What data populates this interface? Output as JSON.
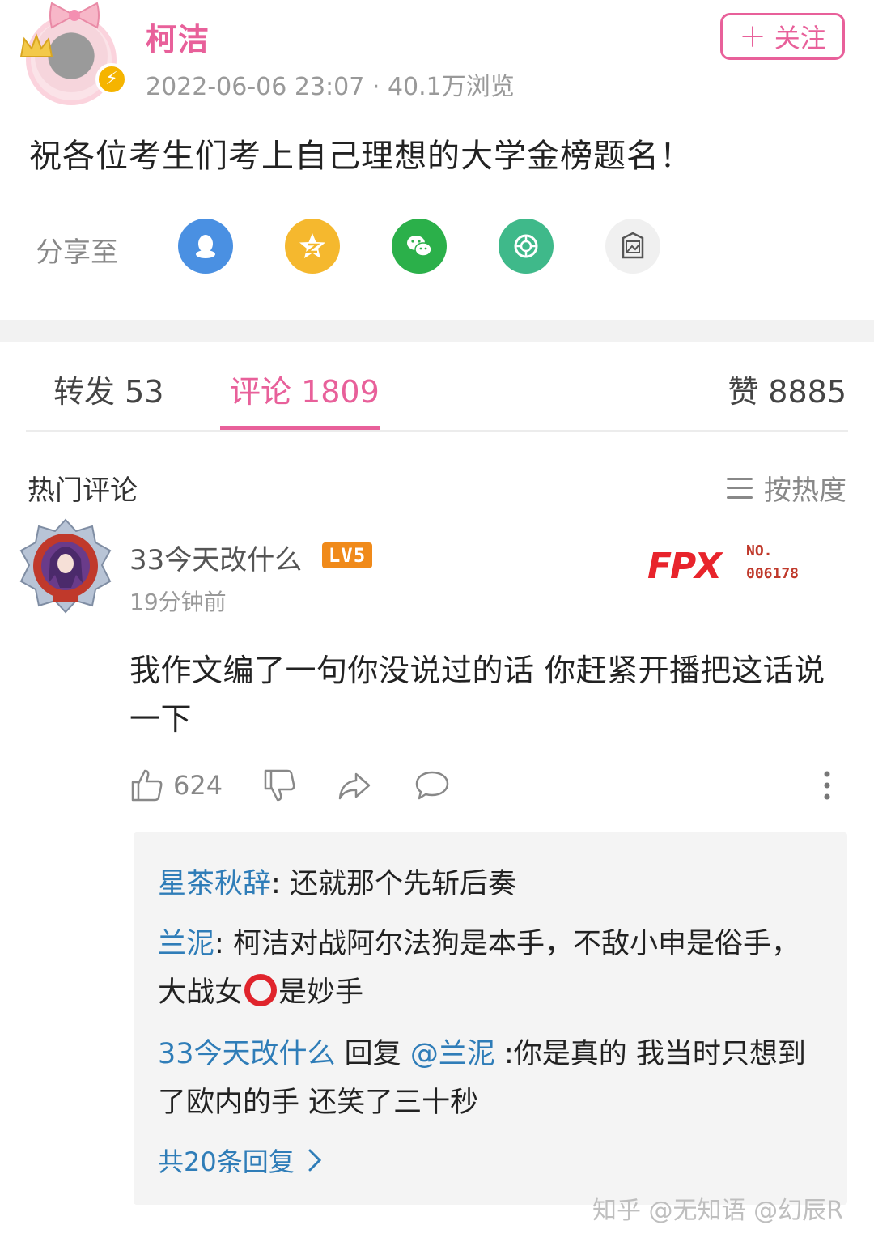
{
  "post": {
    "author": "柯洁",
    "meta": "2022-06-06 23:07 · 40.1万浏览",
    "follow_label": "关注",
    "body": "祝各位考生们考上自己理想的大学金榜题名！"
  },
  "share": {
    "label": "分享至",
    "targets": [
      {
        "icon": "qq-icon",
        "color": "#4a90e2"
      },
      {
        "icon": "qzone-icon",
        "color": "#f5b82e"
      },
      {
        "icon": "wechat-icon",
        "color": "#2bb04a"
      },
      {
        "icon": "moments-icon",
        "color": "#3fb98a"
      },
      {
        "icon": "image-share-icon",
        "color": "#f0f0f0"
      }
    ]
  },
  "tabs": {
    "repost": "转发 53",
    "comments": "评论 1809",
    "likes": "赞 8885"
  },
  "comments_section": {
    "title": "热门评论",
    "sort_label": "按热度"
  },
  "comment": {
    "username": "33今天改什么",
    "level": "LV5",
    "time": "19分钟前",
    "badge": {
      "logo": "FPX",
      "no_label": "NO.",
      "number": "006178"
    },
    "text": "我作文编了一句你没说过的话 你赶紧开播把这话说一下",
    "like_count": "624"
  },
  "replies": [
    {
      "user": "星茶秋辞",
      "sep": ": ",
      "text": "还就那个先斩后奏"
    },
    {
      "user": "兰泥",
      "sep": ": ",
      "text_before": "柯洁对战阿尔法狗是本手，不敌小申是俗手，大战女",
      "text_after": "是妙手"
    },
    {
      "user": "33今天改什么",
      "reply_word": " 回复 ",
      "at": "@兰泥",
      "text": " :你是真的 我当时只想到了欧内的手 还笑了三十秒"
    }
  ],
  "more_replies": "共20条回复",
  "watermark": "知乎 @无知语 @幻辰R"
}
